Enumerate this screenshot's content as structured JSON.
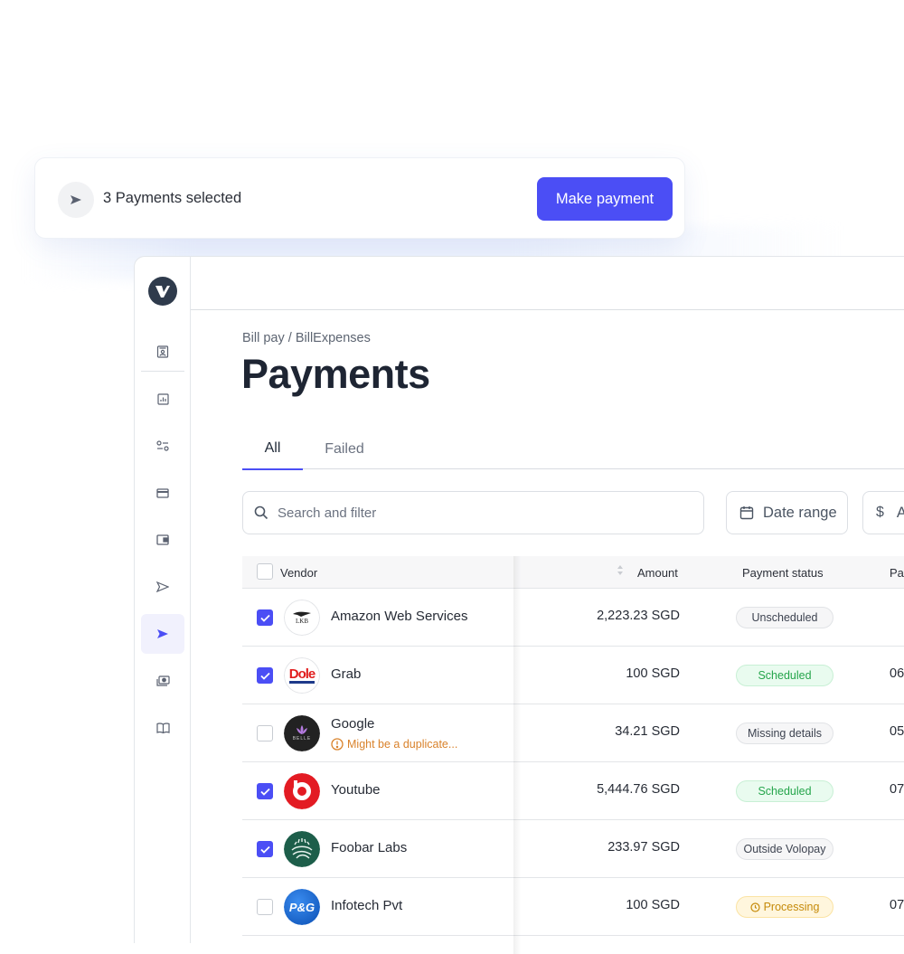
{
  "toast": {
    "icon": "send-icon",
    "text": "3 Payments selected",
    "button_label": "Make payment",
    "accent": "#4b4ef5"
  },
  "sidebar": {
    "logo": "volopay-logo",
    "items": [
      {
        "name": "contacts",
        "icon": "contact-card-icon",
        "active": false
      },
      {
        "name": "analytics",
        "icon": "bar-chart-icon",
        "active": false
      },
      {
        "name": "controls",
        "icon": "sliders-icon",
        "active": false
      },
      {
        "name": "cards",
        "icon": "credit-card-icon",
        "active": false
      },
      {
        "name": "wallet",
        "icon": "wallet-icon",
        "active": false
      },
      {
        "name": "send",
        "icon": "send-outline-icon",
        "active": false
      },
      {
        "name": "bill-pay",
        "icon": "send-filled-icon",
        "active": true
      },
      {
        "name": "reimbursements",
        "icon": "money-icon",
        "active": false
      },
      {
        "name": "accounting",
        "icon": "book-icon",
        "active": false
      }
    ]
  },
  "main": {
    "breadcrumb": "Bill pay / BillExpenses",
    "title": "Payments",
    "tabs": [
      {
        "label": "All",
        "active": true
      },
      {
        "label": "Failed",
        "active": false
      }
    ],
    "search": {
      "placeholder": "Search and filter",
      "value": ""
    },
    "filters": [
      {
        "label": "Date range",
        "icon": "calendar-icon"
      },
      {
        "label": "Amount",
        "icon": "dollar-icon"
      }
    ]
  },
  "table": {
    "columns": {
      "vendor": "Vendor",
      "amount": "Amount",
      "status": "Payment status",
      "date": "Payment date"
    },
    "rows": [
      {
        "checked": true,
        "vendor": "Amazon Web Services",
        "logo": "cheetah-logo",
        "warning": "",
        "amount": "2,223.23 SGD",
        "status": "Unscheduled",
        "status_tone": "gray",
        "date": ""
      },
      {
        "checked": true,
        "vendor": "Grab",
        "logo": "dole-logo",
        "warning": "",
        "amount": "100 SGD",
        "status": "Scheduled",
        "status_tone": "green",
        "date": "06"
      },
      {
        "checked": false,
        "vendor": "Google",
        "logo": "belle-logo",
        "warning": "Might be a duplicate...",
        "amount": "34.21 SGD",
        "status": "Missing details",
        "status_tone": "gray",
        "date": "05"
      },
      {
        "checked": true,
        "vendor": "Youtube",
        "logo": "beats-logo",
        "warning": "",
        "amount": "5,444.76 SGD",
        "status": "Scheduled",
        "status_tone": "green",
        "date": "07"
      },
      {
        "checked": true,
        "vendor": "Foobar Labs",
        "logo": "farm-logo",
        "warning": "",
        "amount": "233.97 SGD",
        "status": "Outside Volopay",
        "status_tone": "gray",
        "date": ""
      },
      {
        "checked": false,
        "vendor": "Infotech Pvt",
        "logo": "pg-logo",
        "warning": "",
        "amount": "100 SGD",
        "status": "Processing",
        "status_tone": "yellow",
        "date": "07"
      }
    ]
  }
}
